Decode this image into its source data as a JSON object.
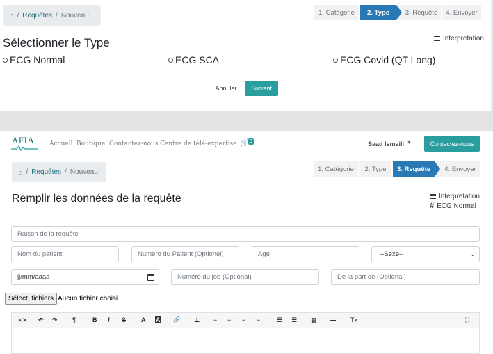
{
  "screen1": {
    "breadcrumb": {
      "items": [
        "Requêtes",
        "Nouveau"
      ]
    },
    "steps": [
      "1. Catégorie",
      "2. Type",
      "3. Requête",
      "4. Envoyer"
    ],
    "active_step": 1,
    "title": "Sélectionner le Type",
    "interpretation": "Interpretation",
    "options": [
      "ECG Normal",
      "ECG SCA",
      "ECG Covid (QT Long)"
    ],
    "cancel": "Annuler",
    "submit": "Suivant"
  },
  "navbar": {
    "logo": "AFIA",
    "links": [
      "Accueil",
      "Boutique",
      "Contactez-nous",
      "Centre de télé-expertise"
    ],
    "cart_count": "0",
    "user": "Saad Ismaili",
    "contact_button": "Contactez-nous"
  },
  "screen2": {
    "breadcrumb": {
      "items": [
        "Requêtes",
        "Nouveau"
      ]
    },
    "steps": [
      "1. Catégorie",
      "2. Type",
      "3. Requête",
      "4. Envoyer"
    ],
    "active_step": 2,
    "title": "Remplir les données de la requête",
    "interpretation": "Interpretation",
    "ecg_type": "ECG Normal",
    "fields": {
      "raison": "Raison de la requête",
      "nom": "Nom du patient",
      "numero_patient": "Numéro du Patient (Optionel)",
      "age": "Age",
      "sexe": "--Sexe--",
      "date": "jj/mm/aaaa",
      "numero_job": "Numéro du job (Optional)",
      "de_la_part": "De la part de (Optional)"
    },
    "file_button": "Sélect. fichiers",
    "file_status": "Aucun fichier choisi"
  },
  "toolbar": [
    "<>",
    "↶",
    "↷",
    "¶",
    "B",
    "I",
    "S",
    "A",
    "A",
    "🔗",
    "⊥",
    "≡",
    "≡",
    "≡",
    "≡",
    "☰",
    "☰",
    "▦",
    "—",
    "Tx",
    "⛶"
  ],
  "colors": {
    "primary": "#2a9d9e",
    "step_active": "#2a79b7",
    "link": "#1b6d78"
  }
}
